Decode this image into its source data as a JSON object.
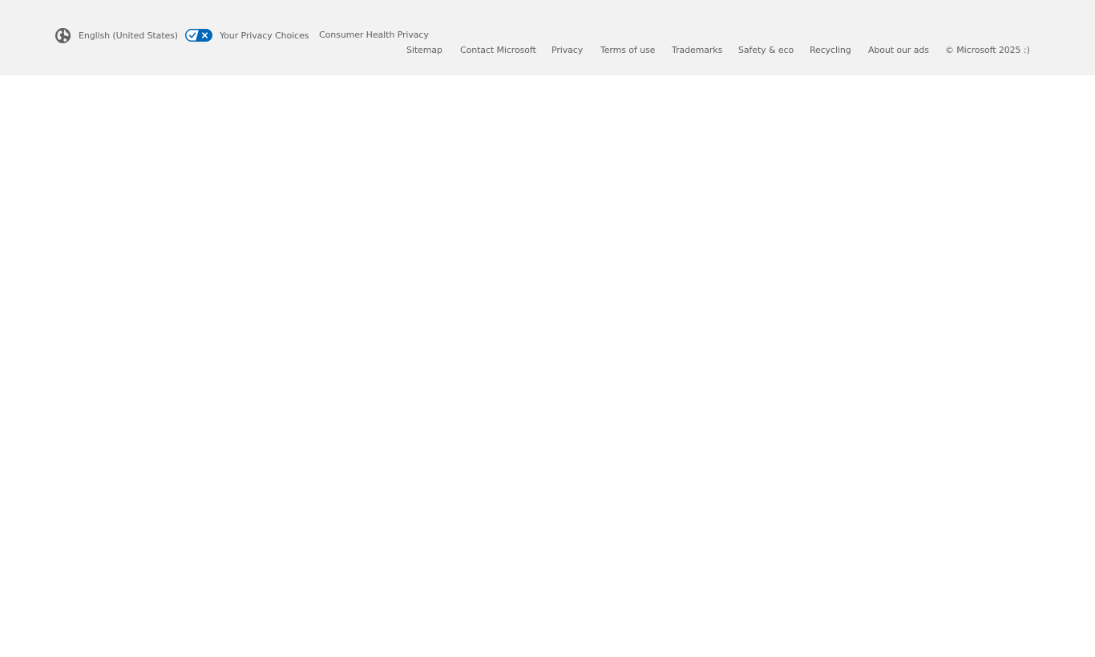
{
  "footer": {
    "locale_label": "English (United States)",
    "locale_icon": "globe-icon",
    "privacy_choices_label": "Your Privacy Choices",
    "privacy_choices_icon": "privacy-toggle-icon",
    "privacy_toggle_color": "#0067b8",
    "consumer_health_label": "Consumer Health Privacy",
    "links": [
      "Sitemap",
      "Contact Microsoft",
      "Privacy",
      "Terms of use",
      "Trademarks",
      "Safety & eco",
      "Recycling",
      "About our ads"
    ],
    "copyright": "© Microsoft 2025 :)"
  },
  "colors": {
    "footer_bg": "#f2f2f2",
    "text": "#616161",
    "page_bg": "#ffffff"
  }
}
